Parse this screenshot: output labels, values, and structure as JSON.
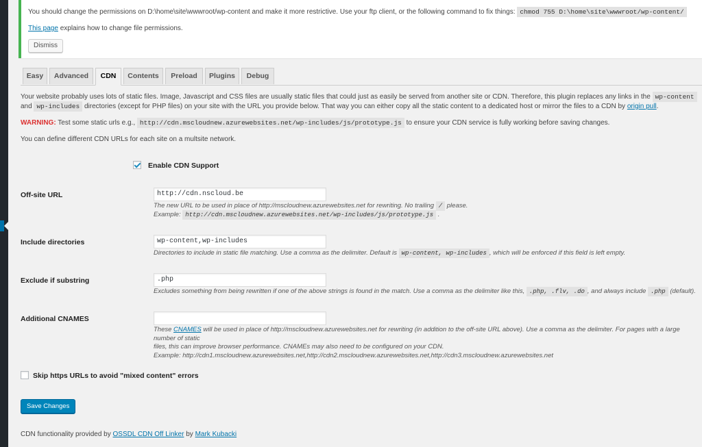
{
  "notice": {
    "message": "You should change the permissions on D:\\home\\site\\wwwroot/wp-content and make it more restrictive. Use your ftp client, or the following command to fix things:",
    "command": "chmod 755 D:\\home\\site\\wwwroot/wp-content/",
    "link_text": "This page",
    "link_suffix": " explains how to change file permissions.",
    "dismiss_label": "Dismiss"
  },
  "tabs": [
    {
      "label": "Easy"
    },
    {
      "label": "Advanced"
    },
    {
      "label": "CDN"
    },
    {
      "label": "Contents"
    },
    {
      "label": "Preload"
    },
    {
      "label": "Plugins"
    },
    {
      "label": "Debug"
    }
  ],
  "intro": {
    "p1_a": "Your website probably uses lots of static files. Image, Javascript and CSS files are usually static files that could just as easily be served from another site or CDN. Therefore, this plugin replaces any links in the",
    "code1": "wp-content",
    "p1_and": "and",
    "code2": "wp-includes",
    "p1_b": "directories (except for PHP files) on your site with the URL you provide below. That way you can either copy all the static content to a dedicated host or mirror the files to a CDN by",
    "origin_pull": "origin pull",
    "p1_end": ".",
    "warning_label": "WARNING:",
    "warning_a": "Test some static urls e.g.,",
    "warning_code": "http://cdn.mscloudnew.azurewebsites.net/wp-includes/js/prototype.js",
    "warning_b": "to ensure your CDN service is fully working before saving changes.",
    "multisite": "You can define different CDN URLs for each site on a multsite network."
  },
  "enable_cdn": {
    "label": "Enable CDN Support",
    "checked": true
  },
  "fields": {
    "offsite": {
      "label": "Off-site URL",
      "value": "http://cdn.nscloud.be",
      "desc1_a": "The new URL to be used in place of http://mscloudnew.azurewebsites.net for rewriting. No trailing",
      "desc1_code": "/",
      "desc1_b": "please.",
      "desc2_a": "Example:",
      "desc2_code": "http://cdn.mscloudnew.azurewebsites.net/wp-includes/js/prototype.js",
      "desc2_b": "."
    },
    "include_dirs": {
      "label": "Include directories",
      "value": "wp-content,wp-includes",
      "desc_a": "Directories to include in static file matching. Use a comma as the delimiter. Default is",
      "desc_code": "wp-content, wp-includes",
      "desc_b": ", which will be enforced if this field is left empty."
    },
    "exclude": {
      "label": "Exclude if substring",
      "value": ".php",
      "desc_a": "Excludes something from being rewritten if one of the above strings is found in the match. Use a comma as the delimiter like this,",
      "desc_code1": ".php, .flv, .do",
      "desc_b": ", and always include",
      "desc_code2": ".php",
      "desc_c": "(default)."
    },
    "cnames": {
      "label": "Additional CNAMES",
      "value": "",
      "desc1_a": "These",
      "desc1_link": "CNAMES",
      "desc1_b": "will be used in place of http://mscloudnew.azurewebsites.net for rewriting (in addition to the off-site URL above). Use a comma as the delimiter. For pages with a large number of static",
      "desc2": "files, this can improve browser performance. CNAMEs may also need to be configured on your CDN.",
      "desc3": "Example: http://cdn1.mscloudnew.azurewebsites.net,http://cdn2.mscloudnew.azurewebsites.net,http://cdn3.mscloudnew.azurewebsites.net"
    }
  },
  "skip_https": {
    "label": "Skip https URLs to avoid \"mixed content\" errors",
    "checked": false
  },
  "save_label": "Save Changes",
  "footer": {
    "prefix": "CDN functionality provided by",
    "link1": "OSSDL CDN Off Linker",
    "mid": "by",
    "link2": "Mark Kubacki"
  }
}
